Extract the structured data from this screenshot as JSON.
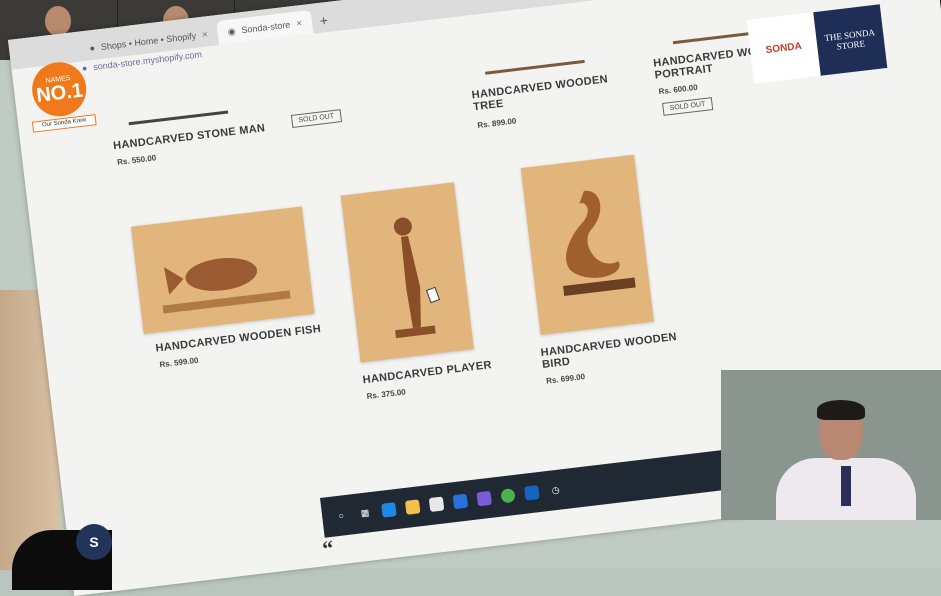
{
  "browser": {
    "tabs": [
      {
        "label": "Shops • Home • Shopify",
        "active": false
      },
      {
        "label": "Sonda-store",
        "active": true
      }
    ],
    "new_tab": "+",
    "close_glyph": "×",
    "address": "sonda-store.myshopify.com"
  },
  "logo": {
    "top": "NAMES",
    "number": "NO.1",
    "tagline": "Our Sonda Krew"
  },
  "products_top": [
    {
      "name": "HANDCARVED STONE MAN",
      "price": "Rs. 550.00",
      "button": "SOLD OUT"
    },
    {
      "name": "HANDCARVED WOODEN TREE",
      "price": "Rs. 899.00"
    },
    {
      "name": "HANDCARVED WOODEN PORTRAIT",
      "price": "Rs. 600.00",
      "button": "SOLD OUT"
    }
  ],
  "products_grid": [
    {
      "name": "HANDCARVED WOODEN FISH",
      "price": "Rs. 599.00"
    },
    {
      "name": "HANDCARVED PLAYER",
      "price": "Rs. 375.00"
    },
    {
      "name": "HANDCARVED WOODEN BIRD",
      "price": "Rs. 699.00"
    }
  ],
  "quote_glyph": "“",
  "brand": {
    "left": "SONDA",
    "right": "THE SONDA STORE"
  },
  "shopify_glyph": "S",
  "colors": {
    "accent": "#f07a1b",
    "brand_navy": "#1f2e57",
    "taskbar": "#1f2833"
  }
}
